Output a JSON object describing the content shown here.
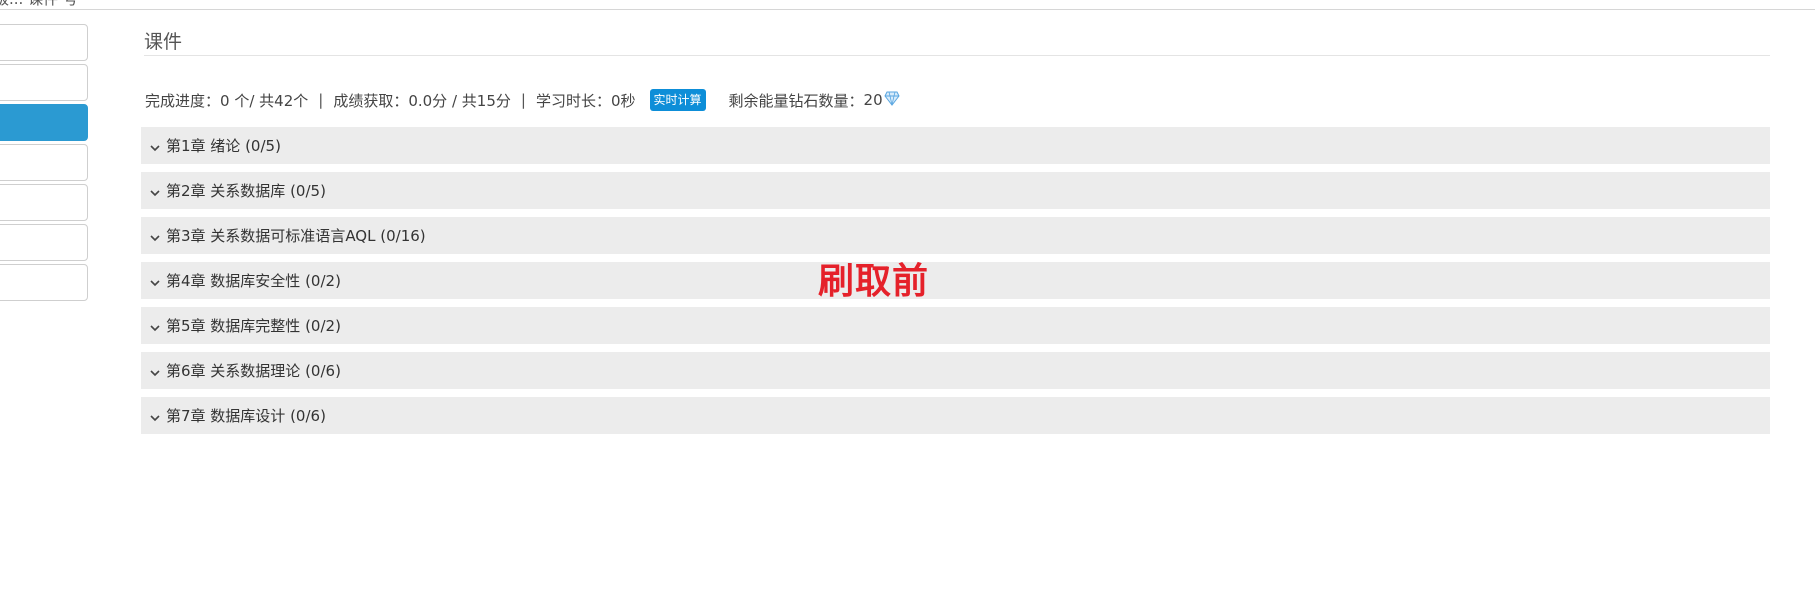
{
  "topbar": {
    "crumb": "级... 课件 号"
  },
  "sidebar": {
    "items": [
      {
        "label": "",
        "active": false
      },
      {
        "label": "",
        "active": false
      },
      {
        "label": "",
        "active": true
      },
      {
        "label": "",
        "active": false
      },
      {
        "label": "",
        "active": false
      },
      {
        "label": "",
        "active": false
      },
      {
        "label": "",
        "active": false
      }
    ]
  },
  "main": {
    "title": "课件",
    "stats": {
      "progress_label": "完成进度：",
      "progress_value": "0 个/ 共42个",
      "score_label": "成绩获取：",
      "score_value": "0.0分 / 共15分",
      "time_label": "学习时长：",
      "time_value": "0秒",
      "separator": "|",
      "realtime_button": "实时计算",
      "diamond_label": "剩余能量钻石数量：",
      "diamond_value": "20",
      "diamond_icon": "diamond-icon",
      "diamond_color": "#5aa6e0"
    },
    "chapters": [
      {
        "label": "第1章 绪论 (0/5)"
      },
      {
        "label": "第2章 关系数据库 (0/5)"
      },
      {
        "label": "第3章 关系数据可标准语言AQL (0/16)"
      },
      {
        "label": "第4章 数据库安全性 (0/2)"
      },
      {
        "label": "第5章 数据库完整性 (0/2)"
      },
      {
        "label": "第6章 关系数据理论 (0/6)"
      },
      {
        "label": "第7章 数据库设计 (0/6)"
      }
    ]
  },
  "overlay": {
    "text": "刷取前",
    "color": "#e5212a"
  },
  "colors": {
    "accent": "#2b9ad2",
    "button": "#0d8ed8",
    "chapter_bg": "#ececec"
  }
}
